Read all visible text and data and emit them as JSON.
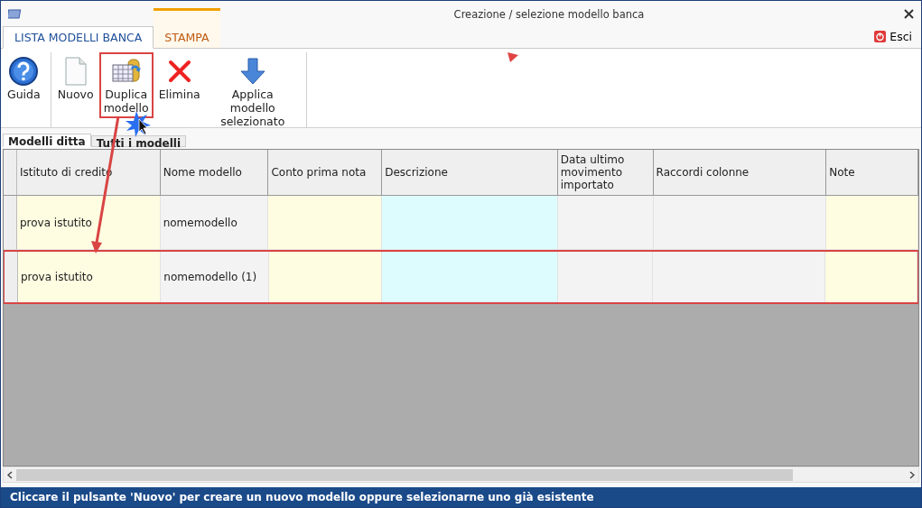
{
  "window": {
    "title": "Creazione / selezione modello banca"
  },
  "ribbon_tabs": [
    {
      "label": "LISTA MODELLI BANCA",
      "selected": true
    },
    {
      "label": "STAMPA",
      "selected": false
    }
  ],
  "exit_button": {
    "label": "Esci"
  },
  "toolbar_groups": [
    [
      {
        "kind": "help",
        "label": "Guida",
        "highlighted": false
      }
    ],
    [
      {
        "kind": "new",
        "label": "Nuovo",
        "highlighted": false
      },
      {
        "kind": "duplicate",
        "label": "Duplica modello",
        "highlighted": true
      },
      {
        "kind": "delete",
        "label": "Elimina",
        "highlighted": false
      },
      {
        "kind": "apply",
        "label": "Applica modello selezionato",
        "highlighted": false
      }
    ]
  ],
  "sub_tabs": [
    {
      "label": "Modelli ditta",
      "selected": true
    },
    {
      "label": "Tutti i modelli",
      "selected": false
    }
  ],
  "table": {
    "columns": [
      {
        "label": "Istituto di credito",
        "color": "#fffde1"
      },
      {
        "label": "Nome modello",
        "color": "#f3f3f3"
      },
      {
        "label": "Conto prima nota",
        "color": "#fffde1"
      },
      {
        "label": "Descrizione",
        "color": "#ddfcfd"
      },
      {
        "label": "Data ultimo movimento importato",
        "color": "#f3f3f3"
      },
      {
        "label": "Raccordi colonne",
        "color": "#f3f3f3"
      },
      {
        "label": "Note",
        "color": "#fffde1"
      }
    ],
    "rows": [
      {
        "cells": [
          "prova istutito",
          "nomemodello",
          "",
          "",
          "",
          "",
          ""
        ],
        "highlighted": false
      },
      {
        "cells": [
          "prova istutito",
          "nomemodello (1)",
          "",
          "",
          "",
          "",
          ""
        ],
        "highlighted": true
      }
    ]
  },
  "status_bar": "Cliccare il pulsante 'Nuovo' per creare un nuovo modello oppure selezionarne uno già esistente"
}
